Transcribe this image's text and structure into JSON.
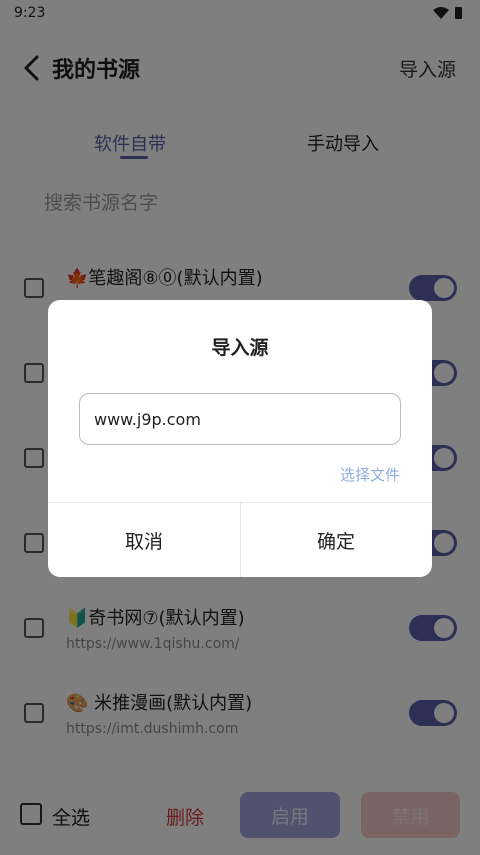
{
  "status_bar": {
    "time": "9:23"
  },
  "header": {
    "title": "我的书源",
    "import_action": "导入源"
  },
  "tabs": [
    {
      "label": "软件自带",
      "active": true
    },
    {
      "label": "手动导入",
      "active": false
    }
  ],
  "search": {
    "placeholder": "搜索书源名字"
  },
  "sources": [
    {
      "name": "🍁笔趣阁⑧⓪(默认内置)",
      "url": "",
      "enabled": true
    },
    {
      "name": "",
      "url": "",
      "enabled": true
    },
    {
      "name": "",
      "url": "",
      "enabled": true
    },
    {
      "name": "",
      "url": "",
      "enabled": true
    },
    {
      "name": "🔰奇书网⑦(默认内置)",
      "url": "https://www.1qishu.com/",
      "enabled": true
    },
    {
      "name": "🎨 米推漫画(默认内置)",
      "url": "https://imt.dushimh.com",
      "enabled": true
    }
  ],
  "bottom_bar": {
    "select_all": "全选",
    "delete": "删除",
    "enable": "启用",
    "disable": "禁用"
  },
  "dialog": {
    "title": "导入源",
    "input_value": "www.j9p.com",
    "choose_file": "选择文件",
    "cancel": "取消",
    "confirm": "确定"
  },
  "colors": {
    "accent": "#5a5fa8",
    "delete": "#d33a3a",
    "link": "#8faee0"
  }
}
